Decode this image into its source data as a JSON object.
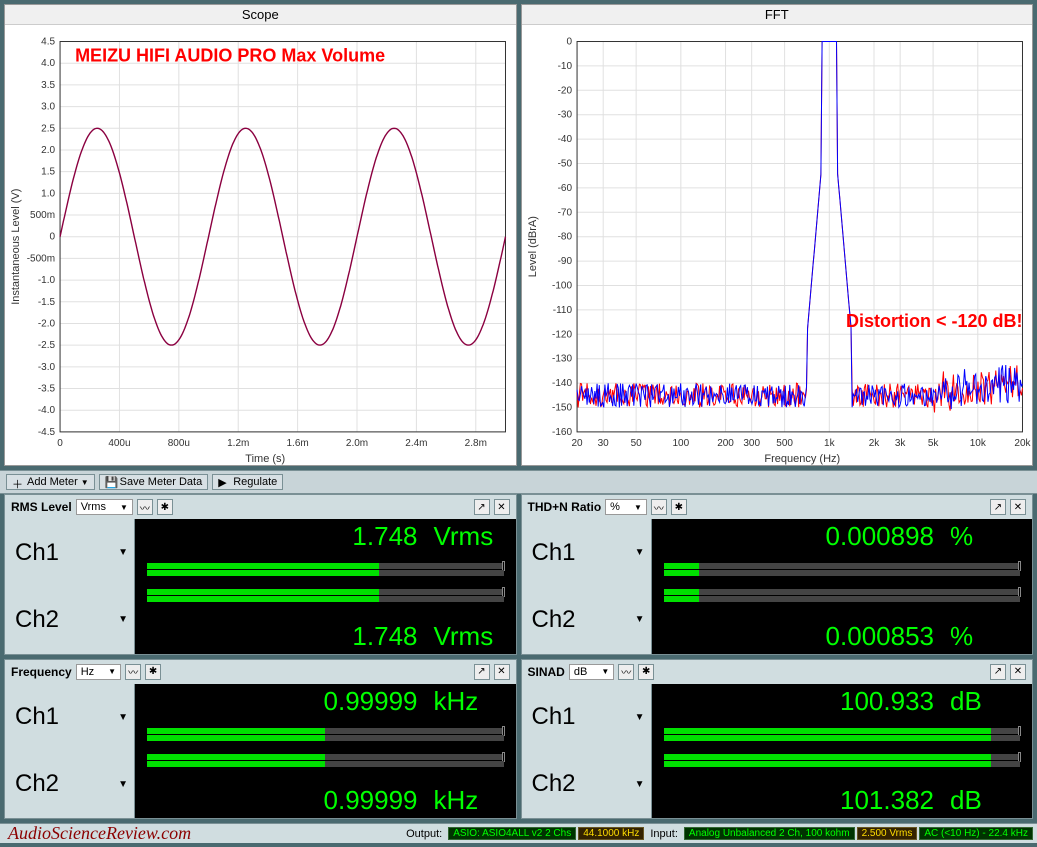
{
  "toolbar": {
    "add_meter": "Add Meter",
    "save_meter_data": "Save Meter Data",
    "regulate": "Regulate"
  },
  "scope": {
    "title": "Scope",
    "xlabel": "Time (s)",
    "ylabel": "Instantaneous Level (V)",
    "annotation": "MEIZU HIFI AUDIO PRO Max Volume"
  },
  "fft": {
    "title": "FFT",
    "xlabel": "Frequency (Hz)",
    "ylabel": "Level (dBrA)",
    "annotation": "Distortion < -120 dB!"
  },
  "meters": {
    "rms": {
      "title": "RMS Level",
      "unit_sel": "Vrms",
      "ch1_label": "Ch1",
      "ch1_val": "1.748",
      "ch1_unit": "Vrms",
      "ch2_label": "Ch2",
      "ch2_val": "1.748",
      "ch2_unit": "Vrms"
    },
    "thdn": {
      "title": "THD+N Ratio",
      "unit_sel": "%",
      "ch1_label": "Ch1",
      "ch1_val": "0.000898",
      "ch1_unit": "%",
      "ch2_label": "Ch2",
      "ch2_val": "0.000853",
      "ch2_unit": "%"
    },
    "freq": {
      "title": "Frequency",
      "unit_sel": "Hz",
      "ch1_label": "Ch1",
      "ch1_val": "0.99999",
      "ch1_unit": "kHz",
      "ch2_label": "Ch2",
      "ch2_val": "0.99999",
      "ch2_unit": "kHz"
    },
    "sinad": {
      "title": "SINAD",
      "unit_sel": "dB",
      "ch1_label": "Ch1",
      "ch1_val": "100.933",
      "ch1_unit": "dB",
      "ch2_label": "Ch2",
      "ch2_val": "101.382",
      "ch2_unit": "dB"
    }
  },
  "statusbar": {
    "asr": "AudioScienceReview.com",
    "output_label": "Output:",
    "output_device": "ASIO: ASIO4ALL v2 2 Chs",
    "output_rate": "44.1000 kHz",
    "input_label": "Input:",
    "input_device": "Analog Unbalanced 2 Ch, 100 kohm",
    "input_vrms": "2.500 Vrms",
    "input_coupling": "AC (<10 Hz) - 22.4 kHz"
  },
  "chart_data": [
    {
      "type": "line",
      "title": "Scope",
      "xlabel": "Time (s)",
      "ylabel": "Instantaneous Level (V)",
      "x_ticks": [
        "0",
        "400u",
        "800u",
        "1.2m",
        "1.6m",
        "2.0m",
        "2.4m",
        "2.8m"
      ],
      "y_ticks": [
        -4.5,
        -4.0,
        -3.5,
        -3.0,
        -2.5,
        -2.0,
        -1.5,
        -1.0,
        -0.5,
        0,
        0.5,
        1.0,
        1.5,
        2.0,
        2.5,
        3.0,
        3.5,
        4.0,
        4.5
      ],
      "xrange_s": [
        0,
        0.003
      ],
      "ylim": [
        -4.5,
        4.5
      ],
      "signal": {
        "freq_hz": 1000,
        "amplitude_v": 2.5,
        "phase_deg": 0
      }
    },
    {
      "type": "line",
      "title": "FFT",
      "xlabel": "Frequency (Hz)",
      "ylabel": "Level (dBrA)",
      "x_scale": "log",
      "x_ticks": [
        20,
        30,
        50,
        100,
        200,
        300,
        500,
        "1k",
        "2k",
        "3k",
        "5k",
        "10k",
        "20k"
      ],
      "y_ticks": [
        0,
        -10,
        -20,
        -30,
        -40,
        -50,
        -60,
        -70,
        -80,
        -90,
        -100,
        -110,
        -120,
        -130,
        -140,
        -150,
        -160
      ],
      "xlim_hz": [
        20,
        20000
      ],
      "ylim": [
        -160,
        0
      ],
      "series": [
        "Ch1",
        "Ch2"
      ],
      "noise_floor_db": -145,
      "fundamental": {
        "freq_hz": 1000,
        "level_db": 0
      },
      "annotation": "Distortion < -120 dB!"
    }
  ]
}
